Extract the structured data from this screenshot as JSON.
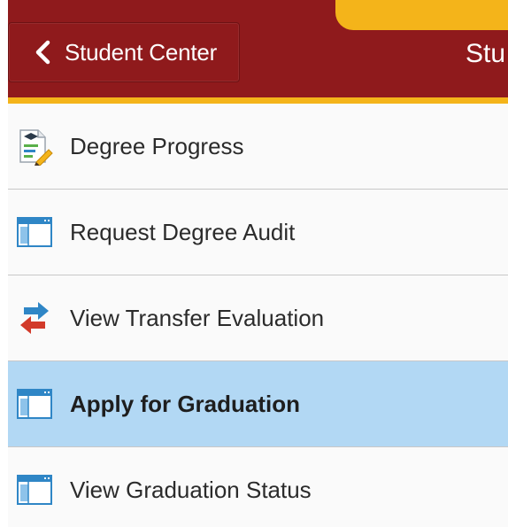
{
  "header": {
    "back_button_label": "Student Center",
    "title_partial": "Stu"
  },
  "colors": {
    "header_bg": "#8f1a1c",
    "accent_gold": "#f4b41a",
    "selected_bg": "#b2d8f4"
  },
  "menu": {
    "items": [
      {
        "label": "Degree Progress",
        "icon": "degree-progress-icon",
        "selected": false
      },
      {
        "label": "Request Degree Audit",
        "icon": "window-page-icon",
        "selected": false
      },
      {
        "label": "View Transfer Evaluation",
        "icon": "transfer-arrows-icon",
        "selected": false
      },
      {
        "label": "Apply for Graduation",
        "icon": "window-page-icon",
        "selected": true
      },
      {
        "label": "View Graduation Status",
        "icon": "window-page-icon",
        "selected": false
      }
    ]
  }
}
